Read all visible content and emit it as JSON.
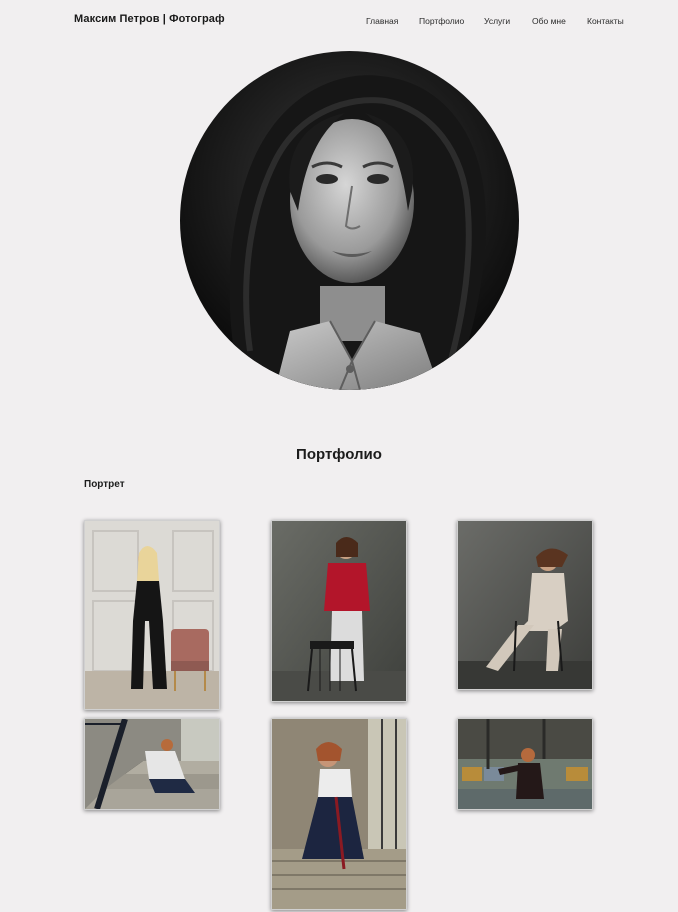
{
  "header": {
    "brand": "Максим Петров | Фотограф",
    "nav": [
      {
        "label": "Главная"
      },
      {
        "label": "Портфолио"
      },
      {
        "label": "Услуги"
      },
      {
        "label": "Обо мне"
      },
      {
        "label": "Контакты"
      }
    ]
  },
  "hero": {
    "subject": "black-and-white portrait of a woman with long wavy hair"
  },
  "portfolio": {
    "title": "Портфолио",
    "category": "Портрет",
    "photos": [
      {
        "subject": "woman in black jumpsuit standing by pink armchair"
      },
      {
        "subject": "woman in red jacket leaning on metal stool"
      },
      {
        "subject": "woman in beige suit seated on chair"
      },
      {
        "subject": "woman sitting on stone staircase"
      },
      {
        "subject": "woman in wide trousers posing on stairs"
      },
      {
        "subject": "woman in dark outfit by window"
      }
    ]
  }
}
